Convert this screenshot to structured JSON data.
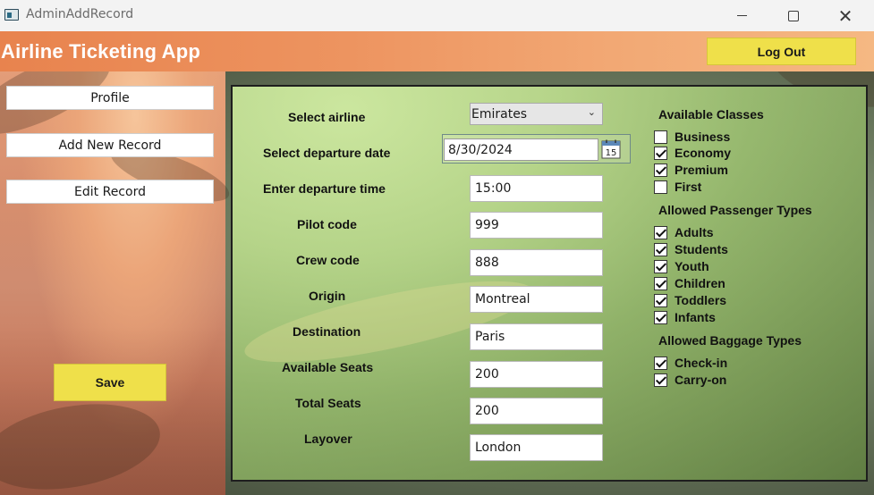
{
  "window": {
    "title": "AdminAddRecord",
    "controls": {
      "minimize": "–",
      "maximize": "□",
      "close": "✕"
    }
  },
  "header": {
    "app_title": "Airline Ticketing App",
    "logout_label": "Log Out"
  },
  "nav": {
    "profile": "Profile",
    "add_new_record": "Add New Record",
    "edit_record": "Edit Record",
    "save": "Save"
  },
  "form": {
    "airline_label": "Select airline",
    "airline_value": "Emirates",
    "date_label": "Select departure date",
    "date_value": "8/30/2024",
    "calendar_day": "15",
    "time_label": "Enter departure time",
    "time_value": "15:00",
    "pilot_label": "Pilot code",
    "pilot_value": "999",
    "crew_label": "Crew code",
    "crew_value": "888",
    "origin_label": "Origin",
    "origin_value": "Montreal",
    "destination_label": "Destination",
    "destination_value": "Paris",
    "available_seats_label": "Available Seats",
    "available_seats_value": "200",
    "total_seats_label": "Total Seats",
    "total_seats_value": "200",
    "layover_label": "Layover",
    "layover_value": "London"
  },
  "classes": {
    "title": "Available Classes",
    "items": [
      {
        "label": "Business",
        "checked": false
      },
      {
        "label": "Economy",
        "checked": true
      },
      {
        "label": "Premium",
        "checked": true
      },
      {
        "label": "First",
        "checked": false
      }
    ]
  },
  "passengers": {
    "title": "Allowed Passenger Types",
    "items": [
      {
        "label": "Adults",
        "checked": true
      },
      {
        "label": "Students",
        "checked": true
      },
      {
        "label": "Youth",
        "checked": true
      },
      {
        "label": "Children",
        "checked": true
      },
      {
        "label": "Toddlers",
        "checked": true
      },
      {
        "label": "Infants",
        "checked": true
      }
    ]
  },
  "baggage": {
    "title": "Allowed Baggage Types",
    "items": [
      {
        "label": "Check-in",
        "checked": true
      },
      {
        "label": "Carry-on",
        "checked": true
      }
    ]
  },
  "colors": {
    "accent_yellow": "#efe04a",
    "header_orange": "#e8834e",
    "panel_green": "#96b46e"
  }
}
